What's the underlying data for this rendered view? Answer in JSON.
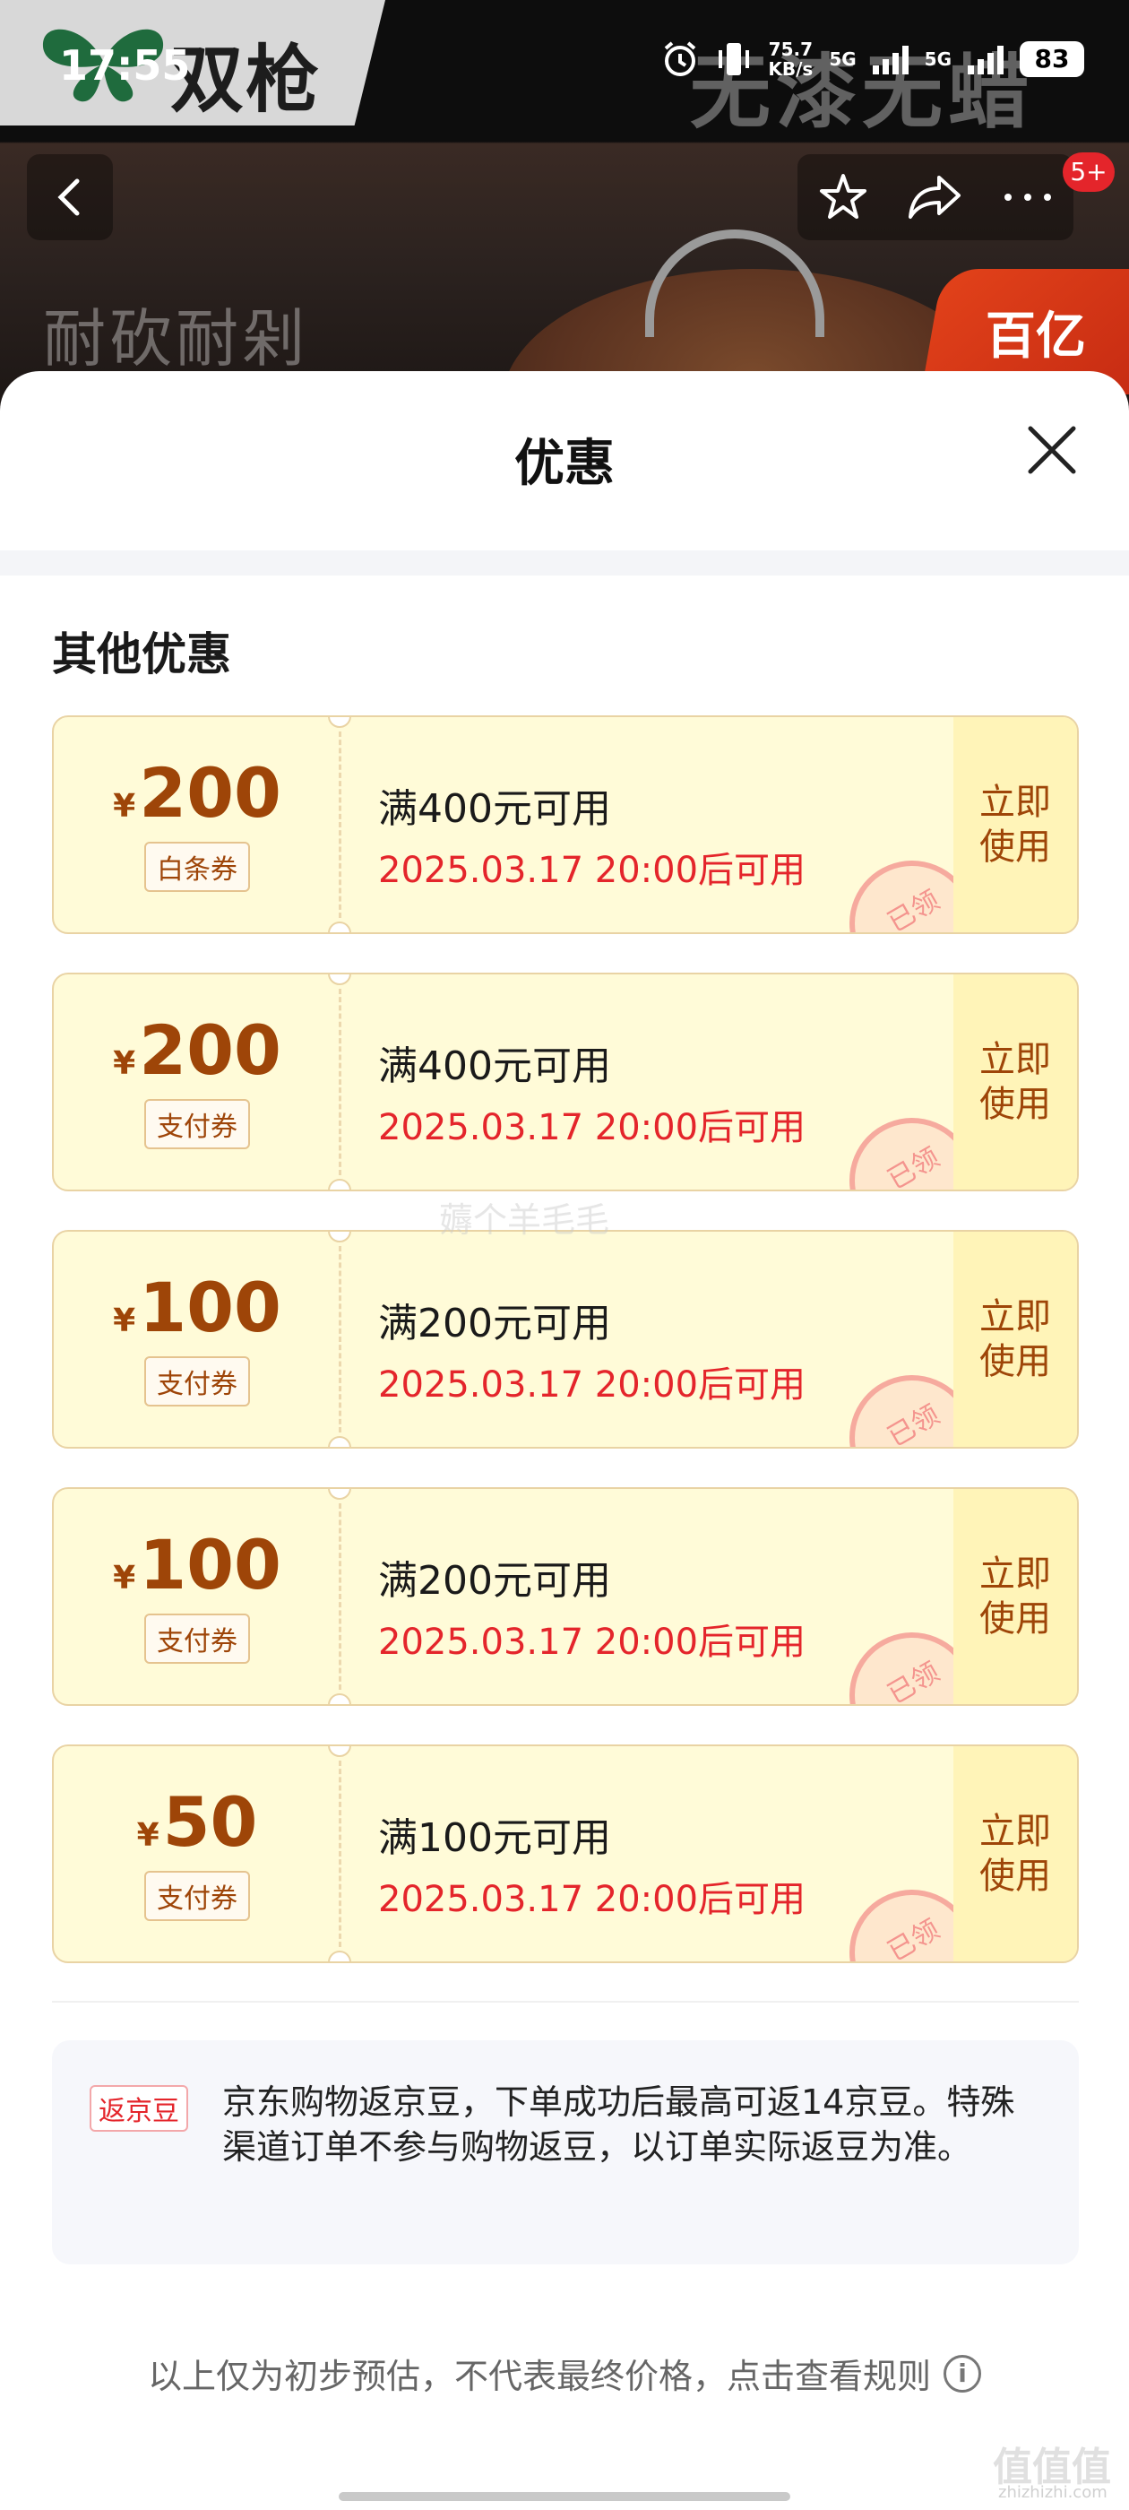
{
  "status_bar": {
    "time": "17:55",
    "speed_top": "75.7",
    "speed_bottom": "KB/s",
    "net1": "5G",
    "net2": "5G",
    "battery": "83"
  },
  "banner": {
    "brand": "双枪",
    "slogan": "无漆无蜡",
    "slogan2": "耐砍耐剁",
    "badge": "百亿"
  },
  "nav": {
    "cart_badge": "5+"
  },
  "sheet": {
    "title": "优惠",
    "section_title": "其他优惠"
  },
  "coupons": [
    {
      "yen": "¥",
      "amount": "200",
      "type": "白条券",
      "condition": "满400元可用",
      "date": "2025.03.17 20:00后可用",
      "use_label": "立即使用",
      "stamp": "已领"
    },
    {
      "yen": "¥",
      "amount": "200",
      "type": "支付券",
      "condition": "满400元可用",
      "date": "2025.03.17 20:00后可用",
      "use_label": "立即使用",
      "stamp": "已领"
    },
    {
      "yen": "¥",
      "amount": "100",
      "type": "支付券",
      "condition": "满200元可用",
      "date": "2025.03.17 20:00后可用",
      "use_label": "立即使用",
      "stamp": "已领"
    },
    {
      "yen": "¥",
      "amount": "100",
      "type": "支付券",
      "condition": "满200元可用",
      "date": "2025.03.17 20:00后可用",
      "use_label": "立即使用",
      "stamp": "已领"
    },
    {
      "yen": "¥",
      "amount": "50",
      "type": "支付券",
      "condition": "满100元可用",
      "date": "2025.03.17 20:00后可用",
      "use_label": "立即使用",
      "stamp": "已领"
    }
  ],
  "beans": {
    "tag": "返京豆",
    "text": "京东购物返京豆，下单成功后最高可返14京豆。特殊渠道订单不参与购物返豆，以订单实际返豆为准。"
  },
  "footer": {
    "note": "以上仅为初步预估，不代表最终价格，点击查看规则",
    "info_icon": "i"
  },
  "watermarks": {
    "center": "薅个羊毛毛",
    "corner": "值值值",
    "corner_url": "zhizhizhi.com"
  },
  "colors": {
    "price": "#9e4508",
    "date": "#e4252b",
    "coupon_bg": "#fffbd8",
    "accent_red": "#e4252b"
  }
}
